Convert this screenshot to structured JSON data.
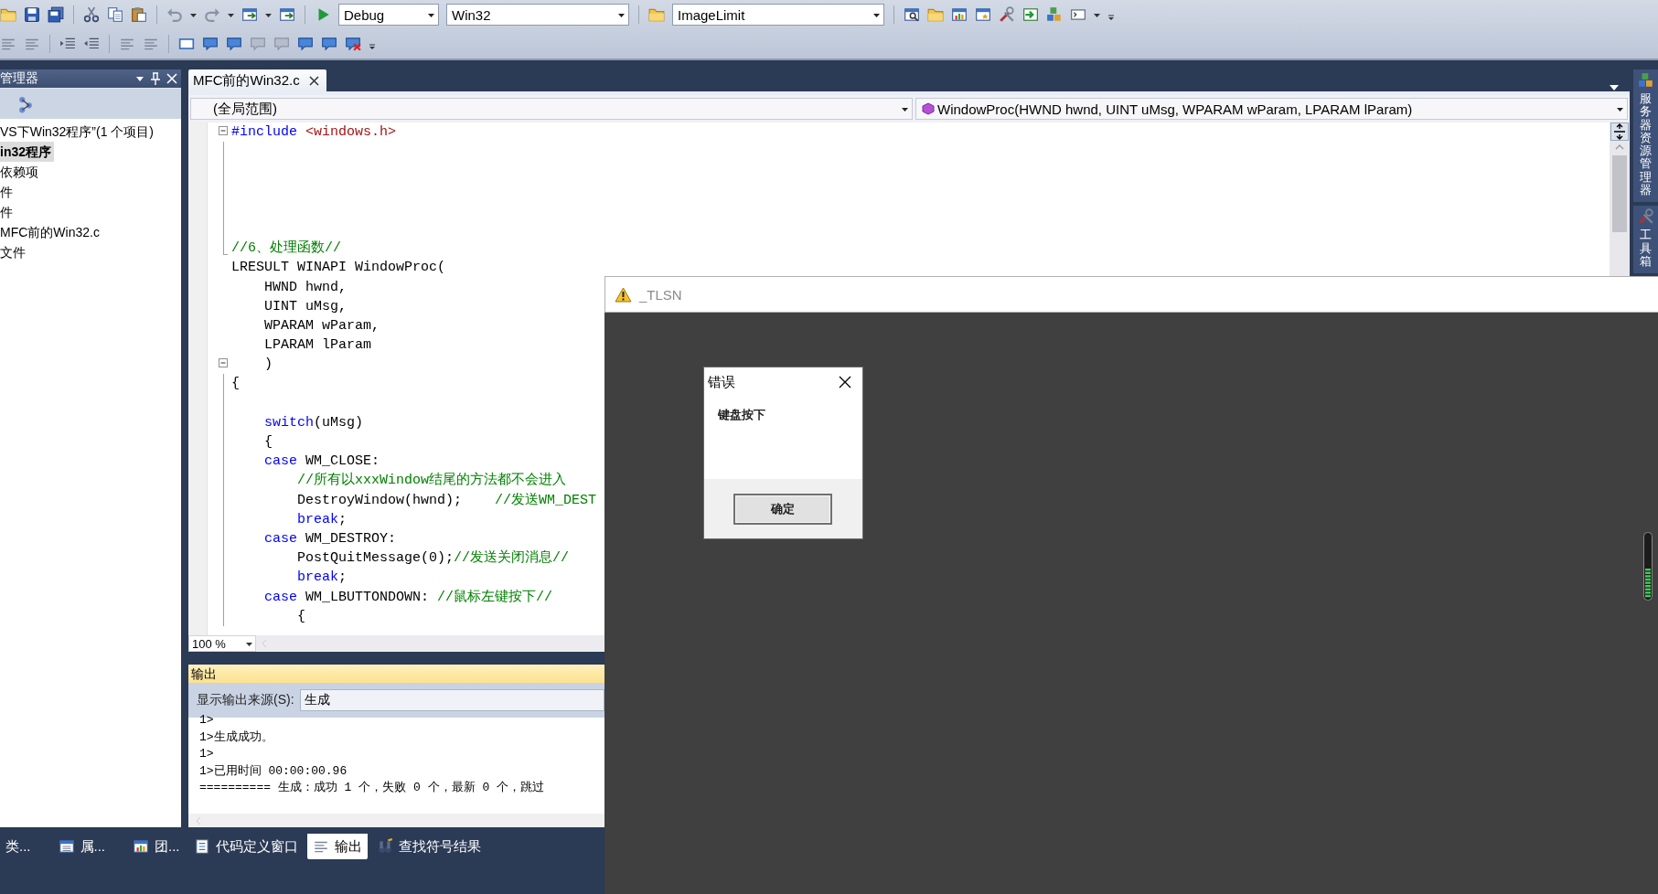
{
  "toolbar": {
    "configuration": "Debug",
    "platform": "Win32",
    "startup_item": "ImageLimit"
  },
  "explorer": {
    "title": "管理器",
    "items": [
      {
        "label": "VS下Win32程序”(1 个项目)",
        "selected": false
      },
      {
        "label": "in32程序",
        "selected": true
      },
      {
        "label": "依赖项",
        "selected": false
      },
      {
        "label": "件",
        "selected": false
      },
      {
        "label": "件",
        "selected": false
      },
      {
        "label": "MFC前的Win32.c",
        "selected": false
      },
      {
        "label": "文件",
        "selected": false
      }
    ]
  },
  "editor": {
    "tabs": [
      {
        "label": "MFC前的Win32.c",
        "selected": true
      }
    ],
    "scope": "(全局范围)",
    "member": "WindowProc(HWND hwnd, UINT uMsg, WPARAM wParam, LPARAM lParam)",
    "zoom": "100 %",
    "lines": [
      {
        "kind": "fold-start",
        "tokens": [
          {
            "text": "#include",
            "kind": "keyword"
          },
          {
            "text": " <windows.h>",
            "kind": "string"
          }
        ]
      },
      {
        "kind": "blank"
      },
      {
        "kind": "blank"
      },
      {
        "kind": "blank"
      },
      {
        "kind": "blank"
      },
      {
        "kind": "blank"
      },
      {
        "kind": "fold-end",
        "tokens": [
          {
            "text": "//6、处理函数//",
            "kind": "comment"
          }
        ]
      },
      {
        "kind": "code",
        "tokens": [
          {
            "text": "LRESULT WINAPI WindowProc(",
            "kind": "plain"
          }
        ]
      },
      {
        "kind": "code",
        "tokens": [
          {
            "text": "    HWND hwnd,",
            "kind": "plain"
          }
        ]
      },
      {
        "kind": "code",
        "tokens": [
          {
            "text": "    UINT uMsg,",
            "kind": "plain"
          }
        ]
      },
      {
        "kind": "code",
        "tokens": [
          {
            "text": "    WPARAM wParam,",
            "kind": "plain"
          }
        ]
      },
      {
        "kind": "code",
        "tokens": [
          {
            "text": "    LPARAM lParam",
            "kind": "plain"
          }
        ]
      },
      {
        "kind": "fold-start",
        "tokens": [
          {
            "text": "    )",
            "kind": "plain"
          }
        ]
      },
      {
        "kind": "code",
        "tokens": [
          {
            "text": "{",
            "kind": "plain"
          }
        ]
      },
      {
        "kind": "blank"
      },
      {
        "kind": "code",
        "tokens": [
          {
            "text": "    switch",
            "kind": "keyword"
          },
          {
            "text": "(uMsg)",
            "kind": "plain"
          }
        ]
      },
      {
        "kind": "code",
        "tokens": [
          {
            "text": "    {",
            "kind": "plain"
          }
        ]
      },
      {
        "kind": "code",
        "tokens": [
          {
            "text": "    case",
            "kind": "keyword"
          },
          {
            "text": " WM_CLOSE:",
            "kind": "plain"
          }
        ]
      },
      {
        "kind": "code",
        "tokens": [
          {
            "text": "        //所有以xxxWindow结尾的方法都不会进入",
            "kind": "comment"
          }
        ]
      },
      {
        "kind": "code",
        "tokens": [
          {
            "text": "        DestroyWindow(hwnd);",
            "kind": "plain"
          },
          {
            "text": "    //发送WM_DEST",
            "kind": "comment"
          }
        ]
      },
      {
        "kind": "code",
        "tokens": [
          {
            "text": "        break",
            "kind": "keyword"
          },
          {
            "text": ";",
            "kind": "plain"
          }
        ]
      },
      {
        "kind": "code",
        "tokens": [
          {
            "text": "    case",
            "kind": "keyword"
          },
          {
            "text": " WM_DESTROY:",
            "kind": "plain"
          }
        ]
      },
      {
        "kind": "code",
        "tokens": [
          {
            "text": "        PostQuitMessage(0);",
            "kind": "plain"
          },
          {
            "text": "//发送关闭消息//",
            "kind": "comment"
          }
        ]
      },
      {
        "kind": "code",
        "tokens": [
          {
            "text": "        break",
            "kind": "keyword"
          },
          {
            "text": ";",
            "kind": "plain"
          }
        ]
      },
      {
        "kind": "code",
        "tokens": [
          {
            "text": "    case",
            "kind": "keyword"
          },
          {
            "text": " WM_LBUTTONDOWN: ",
            "kind": "plain"
          },
          {
            "text": "//鼠标左键按下//",
            "kind": "comment"
          }
        ]
      },
      {
        "kind": "code",
        "tokens": [
          {
            "text": "        {",
            "kind": "plain"
          }
        ]
      }
    ]
  },
  "output": {
    "title": "输出",
    "source_label": "显示输出来源(S):",
    "source": "生成",
    "lines": [
      "1>",
      "1>生成成功。",
      "1>",
      "1>已用时间 00:00:00.96",
      "========== 生成：成功 1 个，失败 0 个，最新 0 个，跳过"
    ]
  },
  "bottom_tabs_left": [
    {
      "label": "类...",
      "selected": false
    },
    {
      "label": "属...",
      "selected": false
    },
    {
      "label": "团...",
      "selected": false
    }
  ],
  "bottom_tabs": [
    {
      "label": "代码定义窗口",
      "selected": false
    },
    {
      "label": "输出",
      "selected": true
    },
    {
      "label": "查找符号结果",
      "selected": false
    }
  ],
  "side_tabs": [
    {
      "label": "服务器资源管理器"
    },
    {
      "label": "工具箱"
    }
  ],
  "app_window": {
    "title": "_TLSN",
    "dialog": {
      "title": "错误",
      "message": "键盘按下",
      "button": "确定"
    }
  }
}
